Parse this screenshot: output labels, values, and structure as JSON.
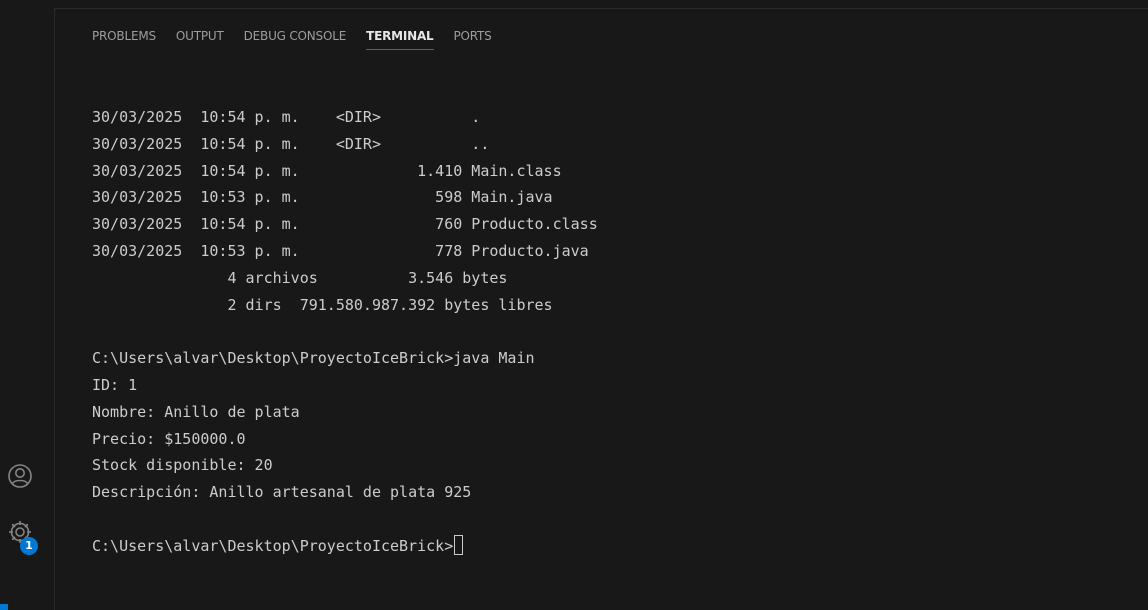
{
  "panel": {
    "tabs": [
      {
        "label": "PROBLEMS",
        "active": false
      },
      {
        "label": "OUTPUT",
        "active": false
      },
      {
        "label": "DEBUG CONSOLE",
        "active": false
      },
      {
        "label": "TERMINAL",
        "active": true
      },
      {
        "label": "PORTS",
        "active": false
      }
    ]
  },
  "activity_bar": {
    "accounts_icon": "account-icon",
    "manage_icon": "gear-icon",
    "badge_count": "1"
  },
  "terminal": {
    "lines": [
      "30/03/2025  10:54 p. m.    <DIR>          .",
      "30/03/2025  10:54 p. m.    <DIR>          ..",
      "30/03/2025  10:54 p. m.             1.410 Main.class",
      "30/03/2025  10:53 p. m.               598 Main.java",
      "30/03/2025  10:54 p. m.               760 Producto.class",
      "30/03/2025  10:53 p. m.               778 Producto.java",
      "               4 archivos          3.546 bytes",
      "               2 dirs  791.580.987.392 bytes libres",
      "",
      "C:\\Users\\alvar\\Desktop\\ProyectoIceBrick>java Main",
      "ID: 1",
      "Nombre: Anillo de plata",
      "Precio: $150000.0",
      "Stock disponible: 20",
      "Descripción: Anillo artesanal de plata 925",
      "",
      "C:\\Users\\alvar\\Desktop\\ProyectoIceBrick>"
    ]
  },
  "colors": {
    "background": "#181818",
    "text": "#cccccc",
    "accent": "#0078d4",
    "inactive_tab": "#9d9d9d"
  }
}
